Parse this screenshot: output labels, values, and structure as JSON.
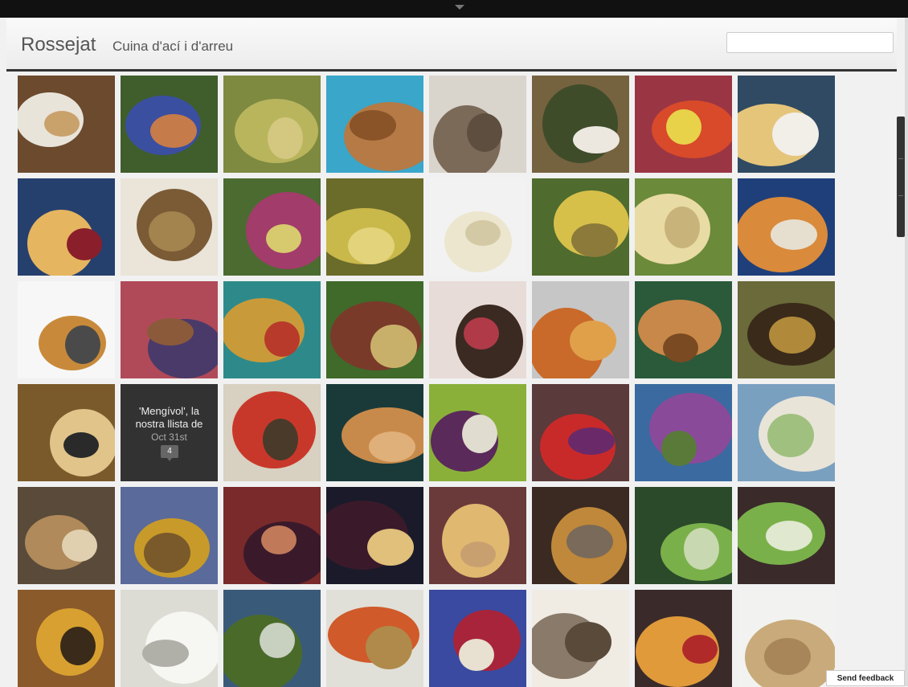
{
  "blog": {
    "title": "Rossejat",
    "subtitle": "Cuina d'ací i d'arreu"
  },
  "search": {
    "placeholder": ""
  },
  "feature_post": {
    "title": "'Mengívol', la nostra llista de",
    "date": "Oct 31st",
    "comments": "4"
  },
  "feedback": {
    "label": "Send feedback"
  },
  "tiles": [
    {
      "icon": "food-photo",
      "colors": [
        "#6b4a2e",
        "#e9e4da",
        "#c9a16b"
      ]
    },
    {
      "icon": "food-photo",
      "colors": [
        "#3f5e2c",
        "#3b4fa0",
        "#c67b4a"
      ]
    },
    {
      "icon": "food-photo",
      "colors": [
        "#7e8a40",
        "#b9b55d",
        "#d4c780"
      ]
    },
    {
      "icon": "food-photo",
      "colors": [
        "#3aa6c9",
        "#b57a45",
        "#8a5428"
      ]
    },
    {
      "icon": "food-photo",
      "colors": [
        "#d9d4cc",
        "#7c6a58",
        "#5e4e3f"
      ]
    },
    {
      "icon": "food-photo",
      "colors": [
        "#75623f",
        "#3f4c2a",
        "#ece8df"
      ]
    },
    {
      "icon": "food-photo",
      "colors": [
        "#9a3544",
        "#d84a2a",
        "#e7d24a"
      ]
    },
    {
      "icon": "food-photo",
      "colors": [
        "#2f4a62",
        "#e5c57a",
        "#f2eee8"
      ]
    },
    {
      "icon": "food-photo",
      "colors": [
        "#26406e",
        "#e6b560",
        "#8a1e2a"
      ]
    },
    {
      "icon": "food-photo",
      "colors": [
        "#eae4d9",
        "#7a5b36",
        "#a3834e"
      ]
    },
    {
      "icon": "food-photo",
      "colors": [
        "#4b6b31",
        "#a23c6b",
        "#d7c96e"
      ]
    },
    {
      "icon": "food-photo",
      "colors": [
        "#6b6b2a",
        "#c9b84a",
        "#e3d37a"
      ]
    },
    {
      "icon": "food-photo",
      "colors": [
        "#f2f2f2",
        "#ece6cf",
        "#d4c9a5"
      ]
    },
    {
      "icon": "food-photo",
      "colors": [
        "#4f6b2e",
        "#d6c04a",
        "#8c7a3a"
      ]
    },
    {
      "icon": "food-photo",
      "colors": [
        "#6b8a3a",
        "#e8dba3",
        "#c8b47a"
      ]
    },
    {
      "icon": "food-photo",
      "colors": [
        "#1f3f7a",
        "#d98a3a",
        "#e6dfd0"
      ]
    },
    {
      "icon": "food-photo",
      "colors": [
        "#f7f7f7",
        "#c88a3a",
        "#4a4a4a"
      ]
    },
    {
      "icon": "food-photo",
      "colors": [
        "#b04a58",
        "#4a3a6a",
        "#8b5a3a"
      ]
    },
    {
      "icon": "food-photo",
      "colors": [
        "#2e8a8a",
        "#c99a3a",
        "#b83a2a"
      ]
    },
    {
      "icon": "food-photo",
      "colors": [
        "#3f6a2a",
        "#7a3a2a",
        "#c9b06a"
      ]
    },
    {
      "icon": "food-photo",
      "colors": [
        "#e8dcd8",
        "#3a2a22",
        "#b03a48"
      ]
    },
    {
      "icon": "food-photo",
      "colors": [
        "#c6c6c6",
        "#c96a2a",
        "#e0a04a"
      ]
    },
    {
      "icon": "food-photo",
      "colors": [
        "#2a5a3a",
        "#c8884a",
        "#7a4a22"
      ]
    },
    {
      "icon": "food-photo",
      "colors": [
        "#6a6a3a",
        "#3a2a1a",
        "#b08a3a"
      ]
    },
    {
      "icon": "food-photo",
      "colors": [
        "#7a5a2a",
        "#e0c48a",
        "#2a2a2a"
      ]
    },
    {
      "icon": "post-tile",
      "colors": [
        "#323232",
        "#323232",
        "#323232"
      ]
    },
    {
      "icon": "food-photo",
      "colors": [
        "#d8d0c0",
        "#c8382a",
        "#4a3a2a"
      ]
    },
    {
      "icon": "food-photo",
      "colors": [
        "#1a3a3a",
        "#c88a4a",
        "#e0b07a"
      ]
    },
    {
      "icon": "food-photo",
      "colors": [
        "#8ab03a",
        "#5a2a5a",
        "#e0dcd0"
      ]
    },
    {
      "icon": "food-photo",
      "colors": [
        "#5a3a3a",
        "#c82a2a",
        "#6a2a6a"
      ]
    },
    {
      "icon": "food-photo",
      "colors": [
        "#3a6aa0",
        "#8a4a9a",
        "#5a7a3a"
      ]
    },
    {
      "icon": "food-photo",
      "colors": [
        "#7aa0c0",
        "#e8e4d8",
        "#a0c080"
      ]
    },
    {
      "icon": "food-photo",
      "colors": [
        "#5a4a3a",
        "#b08a5a",
        "#e0d0b0"
      ]
    },
    {
      "icon": "food-photo",
      "colors": [
        "#5a6a9a",
        "#c89a2a",
        "#7a5a2a"
      ]
    },
    {
      "icon": "food-photo",
      "colors": [
        "#7a2a2a",
        "#3a1a2a",
        "#c07a5a"
      ]
    },
    {
      "icon": "food-photo",
      "colors": [
        "#1a1a2a",
        "#3a1a2a",
        "#e0c07a"
      ]
    },
    {
      "icon": "food-photo",
      "colors": [
        "#6a3a3a",
        "#e0b870",
        "#c8a070"
      ]
    },
    {
      "icon": "food-photo",
      "colors": [
        "#3a2a22",
        "#c0883a",
        "#7a6a5a"
      ]
    },
    {
      "icon": "food-photo",
      "colors": [
        "#2a4a2a",
        "#7ab04a",
        "#c8d8b0"
      ]
    },
    {
      "icon": "food-photo",
      "colors": [
        "#3a2a2a",
        "#7ab04a",
        "#e0e8d0"
      ]
    },
    {
      "icon": "food-photo",
      "colors": [
        "#8a5a2a",
        "#d8a030",
        "#3a2a1a"
      ]
    },
    {
      "icon": "food-photo",
      "colors": [
        "#dcdcd4",
        "#f6f6f2",
        "#b0b0a8"
      ]
    },
    {
      "icon": "food-photo",
      "colors": [
        "#3a5a7a",
        "#4a6a2a",
        "#c8d0c0"
      ]
    },
    {
      "icon": "food-photo",
      "colors": [
        "#e0e0d8",
        "#d05a2a",
        "#b08a4a"
      ]
    },
    {
      "icon": "food-photo",
      "colors": [
        "#3a4aa0",
        "#a8243a",
        "#e8e0d0"
      ]
    },
    {
      "icon": "food-photo",
      "colors": [
        "#f0ece4",
        "#8a7a6a",
        "#5a4a3a"
      ]
    },
    {
      "icon": "food-photo",
      "colors": [
        "#3a2a2a",
        "#e09a3a",
        "#b02a2a"
      ]
    },
    {
      "icon": "food-photo",
      "colors": [
        "#f2f2f0",
        "#c9aa7a",
        "#a8865a"
      ]
    }
  ]
}
